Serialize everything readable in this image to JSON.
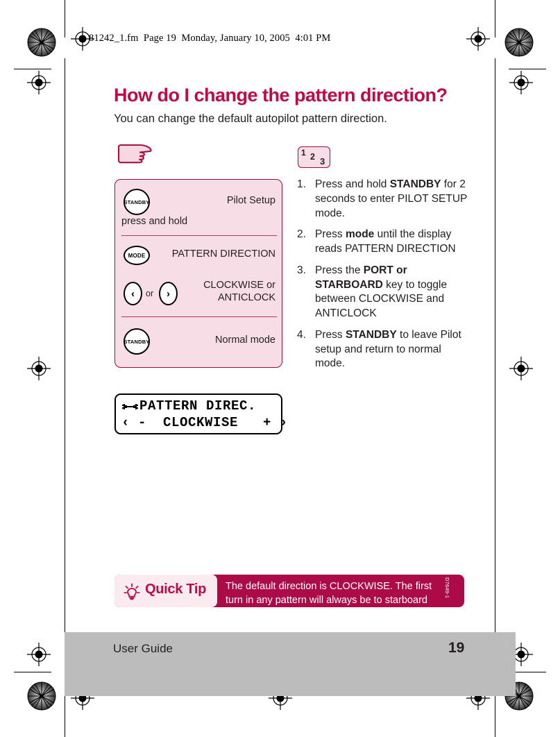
{
  "print_header": {
    "text": "81242_1.fm  Page 19  Monday, January 10, 2005  4:01 PM"
  },
  "page": {
    "title": "How do I change the pattern direction?",
    "intro": "You can change the default autopilot pattern direction."
  },
  "key_panel": {
    "rows": [
      {
        "button": "STANDBY",
        "button_type": "round",
        "label": "Pilot Setup",
        "sub_label": "press and hold"
      },
      {
        "button": "MODE",
        "button_type": "oval",
        "label": "PATTERN DIRECTION",
        "sub_label": ""
      },
      {
        "button": "‹",
        "button_alt": "›",
        "button_type": "arrow-pair",
        "or_text": "or",
        "label_line1": "CLOCKWISE or",
        "label_line2": "ANTICLOCK"
      },
      {
        "button": "STANDBY",
        "button_type": "round",
        "label": "Normal mode",
        "sub_label": ""
      }
    ]
  },
  "lcd_display": {
    "icon": "wrench-icon",
    "line1": "PATTERN DIREC.",
    "line2": "‹ -  CLOCKWISE   + ›"
  },
  "steps_icon": {
    "n1": "1",
    "n2": "2",
    "n3": "3"
  },
  "steps": [
    {
      "num": "1.",
      "parts": [
        {
          "t": "Press and hold ",
          "b": false
        },
        {
          "t": "STANDBY",
          "b": true
        },
        {
          "t": " for 2 seconds to enter PILOT SETUP mode.",
          "b": false
        }
      ]
    },
    {
      "num": "2.",
      "parts": [
        {
          "t": "Press ",
          "b": false
        },
        {
          "t": "mode",
          "b": true
        },
        {
          "t": " until the display reads PATTERN DIRECTION",
          "b": false
        }
      ]
    },
    {
      "num": "3.",
      "parts": [
        {
          "t": "Press the ",
          "b": false
        },
        {
          "t": "PORT or STARBOARD",
          "b": true
        },
        {
          "t": " key to toggle between CLOCKWISE and ANTICLOCK",
          "b": false
        }
      ]
    },
    {
      "num": "4.",
      "parts": [
        {
          "t": "Press ",
          "b": false
        },
        {
          "t": "STANDBY",
          "b": true
        },
        {
          "t": " to leave Pilot setup and return to normal mode.",
          "b": false
        }
      ]
    }
  ],
  "quick_tip": {
    "badge_label": "Quick Tip",
    "icon": "lightbulb-icon",
    "text": "The default direction is CLOCKWISE. The first turn in any pattern will always be to starboard",
    "code": "D7649-1"
  },
  "footer": {
    "title": "User Guide",
    "page_number": "19"
  },
  "colors": {
    "brand_crimson": "#be0a47",
    "tip_bar": "#ad0b47",
    "panel_pink": "#f7dde6",
    "panel_border": "#9e0b3e",
    "footer_gray": "#bcbcbc"
  }
}
